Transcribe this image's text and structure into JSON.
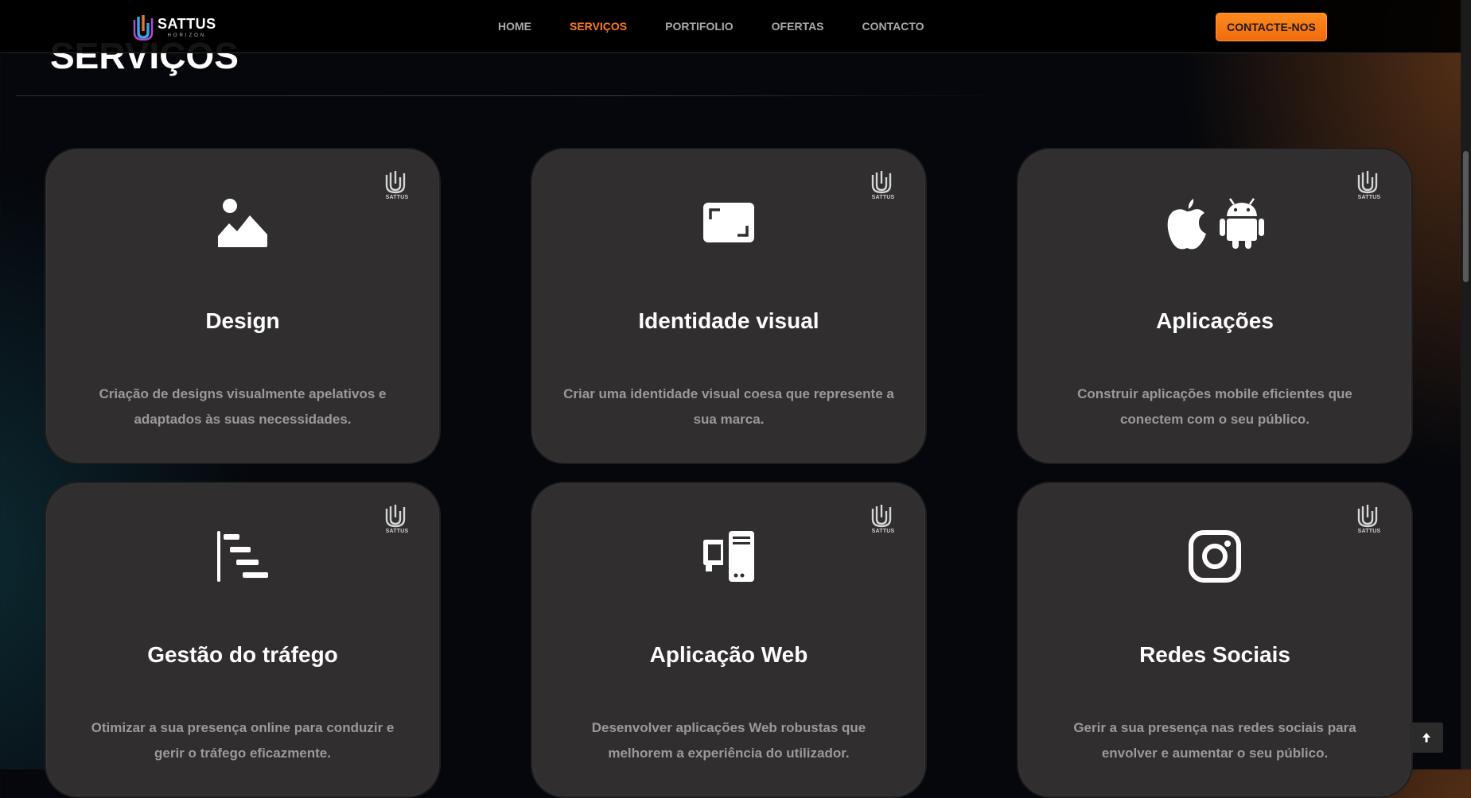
{
  "brand": {
    "name": "SATTUS",
    "tagline": "HORIZON"
  },
  "nav": {
    "items": [
      {
        "label": "HOME",
        "active": false
      },
      {
        "label": "SERVIÇOS",
        "active": true
      },
      {
        "label": "PORTIFOLIO",
        "active": false
      },
      {
        "label": "OFERTAS",
        "active": false
      },
      {
        "label": "CONTACTO",
        "active": false
      }
    ],
    "cta_label": "CONTACTE-NOS"
  },
  "section": {
    "title": "SERVIÇOS"
  },
  "colors": {
    "accent": "#ff7a1a",
    "card_bg": "#302e2e",
    "desc_text": "#9a9a9a"
  },
  "services": [
    {
      "icon": "image-icon",
      "title": "Design",
      "description": "Criação de designs visualmente apelativos e adaptados às suas necessidades.",
      "badge": "SATTUS"
    },
    {
      "icon": "expand-screen-icon",
      "title": "Identidade visual",
      "description": "Criar uma identidade visual coesa que represente a sua marca.",
      "badge": "SATTUS"
    },
    {
      "icon": "apple-android-icon",
      "title": "Aplicações",
      "description": "Construir aplicações mobile eficientes que conectem com o seu público.",
      "badge": "SATTUS"
    },
    {
      "icon": "stream-icon",
      "title": "Gestão do tráfego",
      "description": "Otimizar a sua presença online para conduzir e gerir o tráfego eficazmente.",
      "badge": "SATTUS"
    },
    {
      "icon": "desktop-tower-icon",
      "title": "Aplicação Web",
      "description": "Desenvolver aplicações Web robustas que melhorem a experiência do utilizador.",
      "badge": "SATTUS"
    },
    {
      "icon": "instagram-icon",
      "title": "Redes Sociais",
      "description": "Gerir a sua presença nas redes sociais para envolver e aumentar o seu público.",
      "badge": "SATTUS"
    }
  ],
  "scroll_to_top": {
    "icon": "arrow-up-icon"
  }
}
